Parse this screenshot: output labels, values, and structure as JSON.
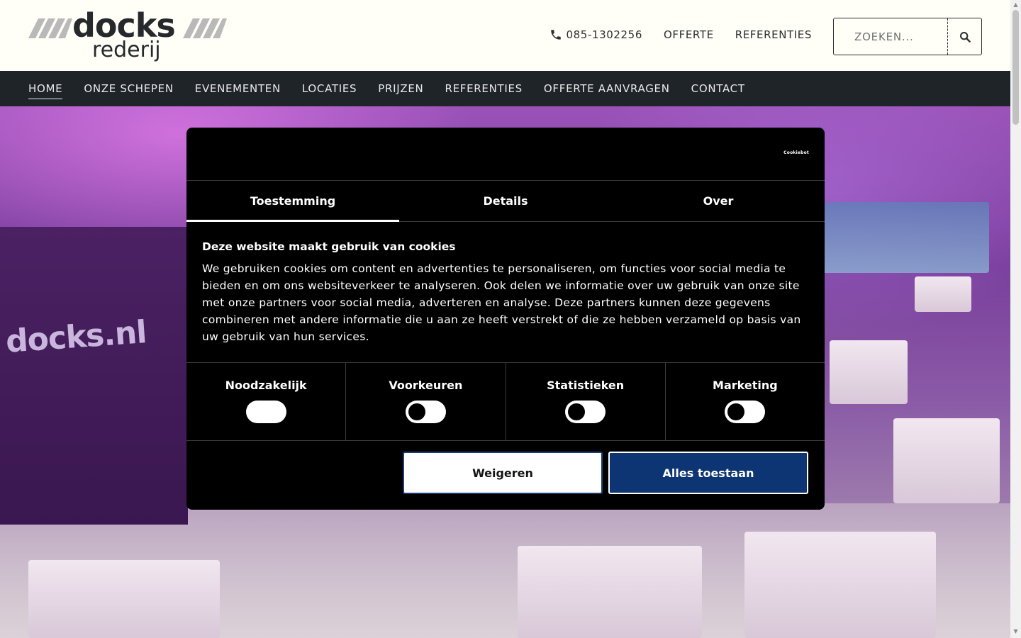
{
  "header": {
    "logo": {
      "word": "docks",
      "sub": "rederij"
    },
    "phone": "085-1302256",
    "links": [
      "OFFERTE",
      "REFERENTIES"
    ],
    "search": {
      "placeholder": "ZOEKEN..."
    }
  },
  "nav": {
    "items": [
      "HOME",
      "ONZE SCHEPEN",
      "EVENEMENTEN",
      "LOCATIES",
      "PRIJZEN",
      "REFERENTIES",
      "OFFERTE AANVRAGEN",
      "CONTACT"
    ],
    "active": "HOME"
  },
  "hero": {
    "brand_text": "docks.nl"
  },
  "cookie_dialog": {
    "brand": "Cookiebot",
    "tabs": [
      "Toestemming",
      "Details",
      "Over"
    ],
    "active_tab": "Toestemming",
    "title": "Deze website maakt gebruik van cookies",
    "text": "We gebruiken cookies om content en advertenties te personaliseren, om functies voor social media te bieden en om ons websiteverkeer te analyseren. Ook delen we informatie over uw gebruik van onze site met onze partners voor social media, adverteren en analyse. Deze partners kunnen deze gegevens combineren met andere informatie die u aan ze heeft verstrekt of die ze hebben verzameld op basis van uw gebruik van hun services.",
    "toggles": [
      {
        "label": "Noodzakelijk",
        "state": "disabled"
      },
      {
        "label": "Voorkeuren",
        "state": "off"
      },
      {
        "label": "Statistieken",
        "state": "off"
      },
      {
        "label": "Marketing",
        "state": "off"
      }
    ],
    "buttons": {
      "deny": "Weigeren",
      "allow": "Alles toestaan"
    }
  },
  "colors": {
    "nav_bg": "#1f2428",
    "allow_button": "#0d3573",
    "dialog_bg": "#000000"
  }
}
